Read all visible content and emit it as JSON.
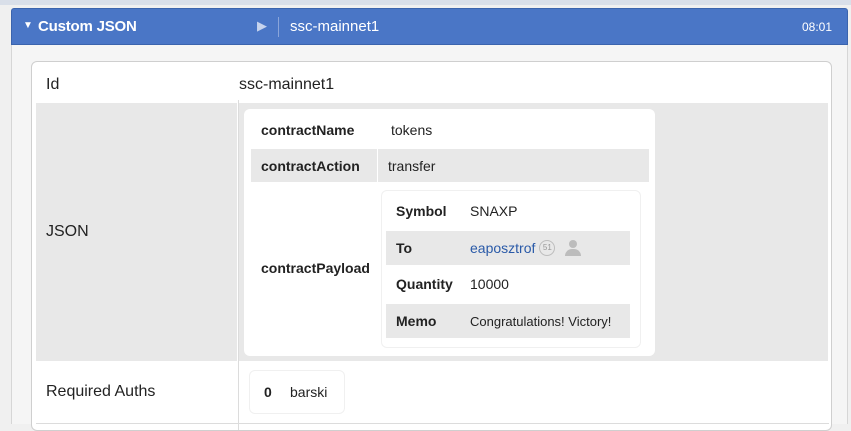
{
  "header": {
    "title": "Custom JSON",
    "tx_title": "ssc-mainnet1",
    "time": "08:01"
  },
  "op": {
    "id_label": "Id",
    "id_value": "ssc-mainnet1",
    "json_label": "JSON",
    "required_auths_label": "Required Auths",
    "json": {
      "contract_name_key": "contractName",
      "contract_name_value": "tokens",
      "contract_action_key": "contractAction",
      "contract_action_value": "transfer",
      "contract_payload_key": "contractPayload",
      "payload": {
        "symbol_key": "Symbol",
        "symbol_value": "SNAXP",
        "to_key": "To",
        "to_value": "eaposztrof",
        "to_reputation": "51",
        "quantity_key": "Quantity",
        "quantity_value": "10000",
        "memo_key": "Memo",
        "memo_value": "Congratulations! Victory!"
      }
    },
    "required_auths": [
      {
        "index": "0",
        "account": "barski"
      }
    ]
  },
  "colors": {
    "header_bg": "#4a76c6",
    "link": "#2a5aa8",
    "row_alt": "#ececec"
  }
}
